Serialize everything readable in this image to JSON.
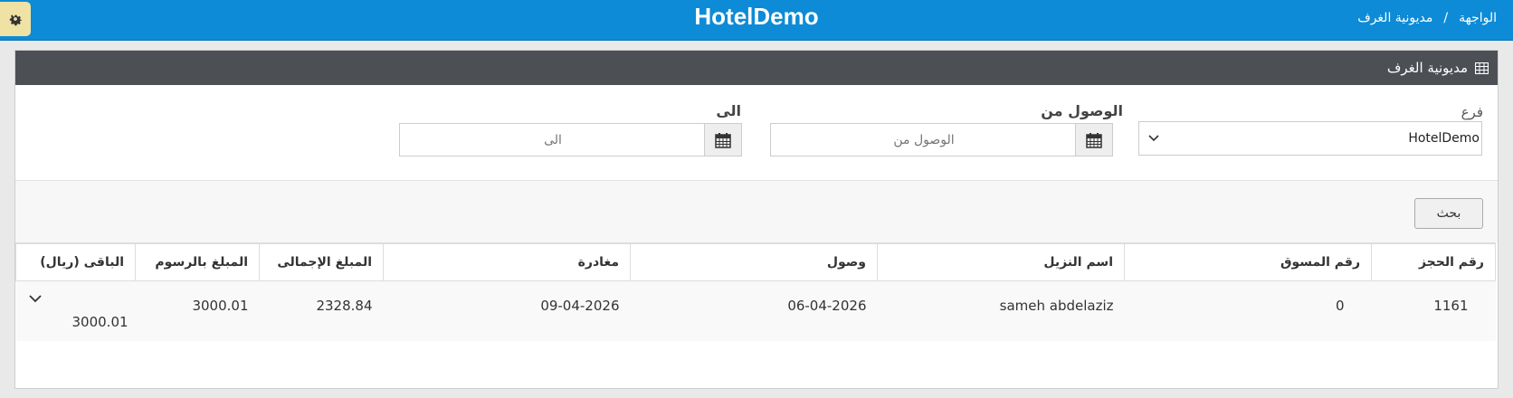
{
  "topbar": {
    "title": "HotelDemo",
    "breadcrumb": [
      "الواجهة",
      "/",
      "مديونية الغرف"
    ]
  },
  "panel": {
    "title": "مديونية الغرف"
  },
  "filters": {
    "branch_label": "فرع",
    "branch_value": "HotelDemo",
    "from_label": "الوصول من",
    "from_placeholder": "الوصول من",
    "to_label": "الى",
    "to_placeholder": "الى"
  },
  "search": {
    "button_label": "بحث"
  },
  "table": {
    "headers": [
      "رقم الحجز",
      "رقم المسوق",
      "اسم النزيل",
      "وصول",
      "مغادرة",
      "المبلغ الإجمالى",
      "المبلغ بالرسوم",
      "الباقى (ريال)"
    ],
    "rows": [
      [
        "1161",
        "0",
        "sameh abdelaziz",
        "06-04-2026",
        "09-04-2026",
        "2328.84",
        "3000.01",
        "3000.01"
      ]
    ]
  },
  "colors": {
    "topbar": "#0d8bd6",
    "panel_head": "#4c4f53",
    "gear_bg": "#efe2a4"
  }
}
